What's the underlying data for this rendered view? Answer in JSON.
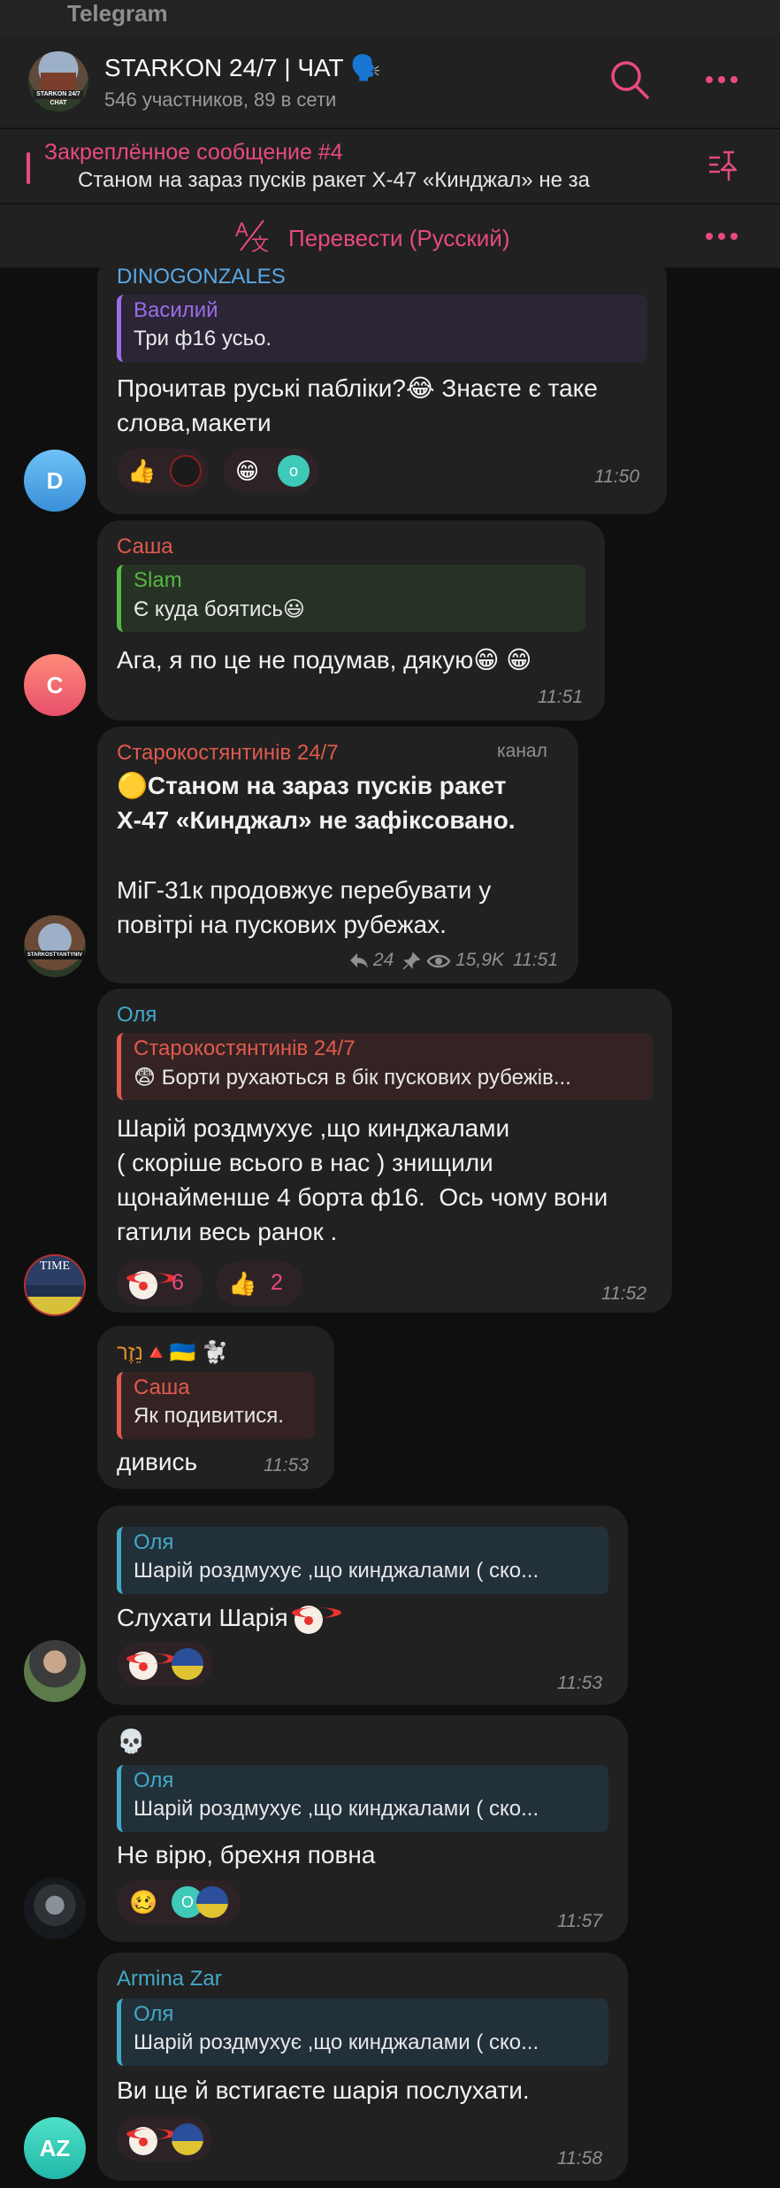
{
  "app": {
    "title": "Telegram"
  },
  "header": {
    "avatar_tag": "STARKON 24/7 CHAT",
    "chat_name": "STARKON 24/7 | ЧАТ 🗣️",
    "subtitle": "546 участников, 89 в сети",
    "icons": [
      "search-icon",
      "more-icon"
    ],
    "accent_color": "#e84a7f"
  },
  "pinned": {
    "title": "Закреплённое сообщение #4",
    "text": "Станом на зараз пусків ракет Х-47 «Кинджал» не за"
  },
  "translate": {
    "label": "Перевести (Русский)"
  },
  "messages": [
    {
      "sender": "DINOGONZALES",
      "reply_name": "Василий",
      "reply_text": "Три ф16 усьо.",
      "body": "Прочитав руські пабліки?😂 Знаєте є таке\nслова,макети",
      "reactions": [
        "👍",
        "😁"
      ],
      "time": "11:50",
      "avatar_letter": "D"
    },
    {
      "sender": "Саша",
      "reply_name": "Slam",
      "reply_text": "Є куда боятись😃",
      "body": "Ага, я по це не подумав, дякую😁 😁",
      "time": "11:51",
      "avatar_letter": "C"
    },
    {
      "sender": "Старокостянтинів 24/7",
      "badge": "канал",
      "body_bold": "🟡Станом на зараз пусків ракет\nХ-47 «Кинджал» не зафіксовано.",
      "body": "МіГ-31к продовжує перебувати у\nповітрі на пускових рубежах.",
      "forwards": "24",
      "views": "15,9K",
      "time": "11:51",
      "avatar_tag": "STARKOSTYANTYNIV"
    },
    {
      "sender": "Оля",
      "reply_name": "Старокостянтинів 24/7",
      "reply_text": "😨 Борти рухаються в бік пускових рубежів...",
      "body": "Шарій роздмухує ,що кинджалами\n( скоріше всього в нас ) знищили\nщонайменше 4 борта ф16.  Ось чому вони\nгатили весь ранок .",
      "reactions": [
        {
          "emoji": "clown",
          "count": "6"
        },
        {
          "emoji": "👍",
          "count": "2"
        }
      ],
      "time": "11:52",
      "avatar_tag": "TIME"
    },
    {
      "sender": "נֵזֶר🔺🇺🇦 🐩",
      "reply_name": "Саша",
      "reply_text": "Як подивитися.",
      "body": "дивись",
      "time": "11:53"
    },
    {
      "reply_name": "Оля",
      "reply_text": "Шарій роздмухує ,що кинджалами ( ско...",
      "body": "Слухати Шарія",
      "time": "11:53"
    },
    {
      "sender": "💀",
      "reply_name": "Оля",
      "reply_text": "Шарій роздмухує ,що кинджалами ( ско...",
      "body": "Не вірю, брехня повна",
      "reactions": [
        "🥴"
      ],
      "mini_avatar_letter": "O",
      "time": "11:57"
    },
    {
      "sender": "Armina Zar",
      "reply_name": "Оля",
      "reply_text": "Шарій роздмухує ,що кинджалами ( ско...",
      "body": "Ви ще й встигаєте шарія послухати.",
      "time": "11:58",
      "avatar_letter": "AZ"
    }
  ],
  "colors": {
    "bubble": "#212121",
    "blue": "#5aa8e6",
    "red": "#e05a4e",
    "green": "#57b647",
    "purple": "#9b6de6",
    "cyan": "#42a9c8",
    "orange": "#e08e2c"
  }
}
